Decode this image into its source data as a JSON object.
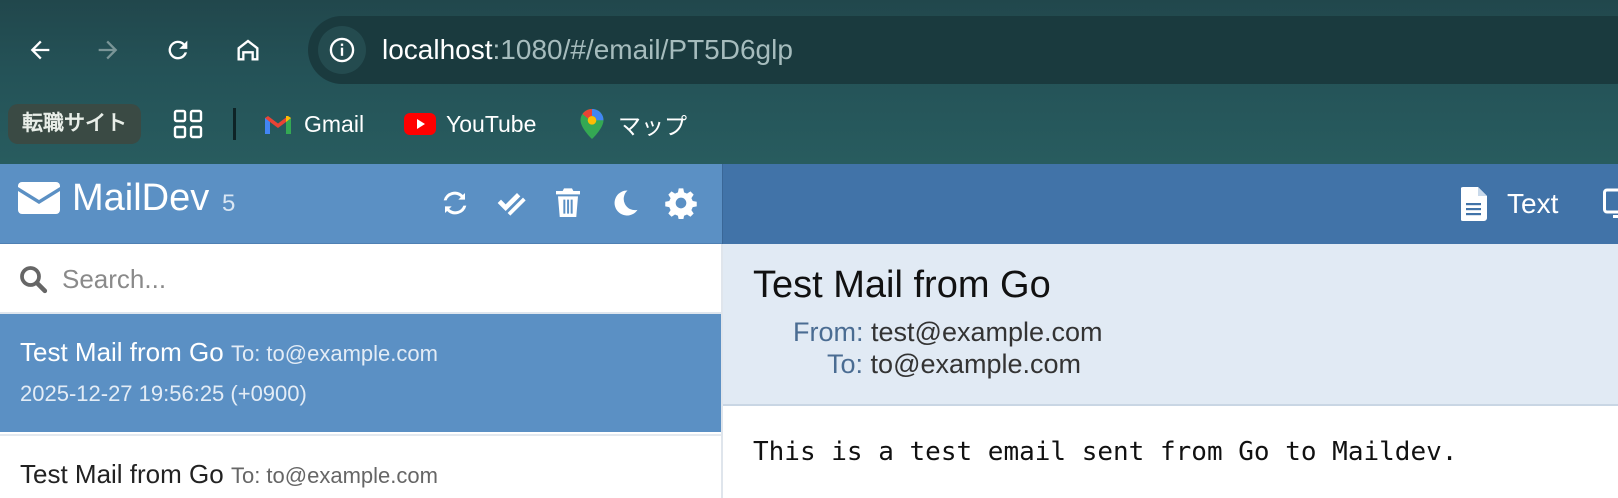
{
  "browser": {
    "url_host": "localhost",
    "url_path": ":1080/#/email/PT5D6glp",
    "bookmarks": {
      "folder_label": "転職サイト",
      "items": [
        {
          "label": "Gmail",
          "icon": "gmail-icon"
        },
        {
          "label": "YouTube",
          "icon": "youtube-icon"
        },
        {
          "label": "マップ",
          "icon": "maps-icon"
        }
      ]
    },
    "nav_icons": [
      "back-icon",
      "forward-icon",
      "reload-icon",
      "home-icon",
      "site-info-icon"
    ]
  },
  "app": {
    "title": "MailDev",
    "count": "5",
    "header_icons": [
      "refresh-icon",
      "mark-all-read-icon",
      "trash-icon",
      "dark-mode-icon",
      "settings-icon"
    ],
    "colors": {
      "header": "#5b90c4",
      "detail_header": "#4173a8",
      "selected_row": "#5b90c4",
      "detail_bg": "#e1eaf4"
    }
  },
  "search": {
    "placeholder": "Search..."
  },
  "mail_list": [
    {
      "subject": "Test Mail from Go",
      "to": "To: to@example.com",
      "date": "2025-12-27 19:56:25 (+0900)",
      "selected": true
    },
    {
      "subject": "Test Mail from Go",
      "to": "To: to@example.com",
      "selected": false
    }
  ],
  "detail": {
    "view_tab_label": "Text",
    "subject": "Test Mail from Go",
    "from_label": "From:",
    "from_value": "test@example.com",
    "to_label": "To:",
    "to_value": "to@example.com",
    "body": "This is a test email sent from Go to Maildev."
  }
}
